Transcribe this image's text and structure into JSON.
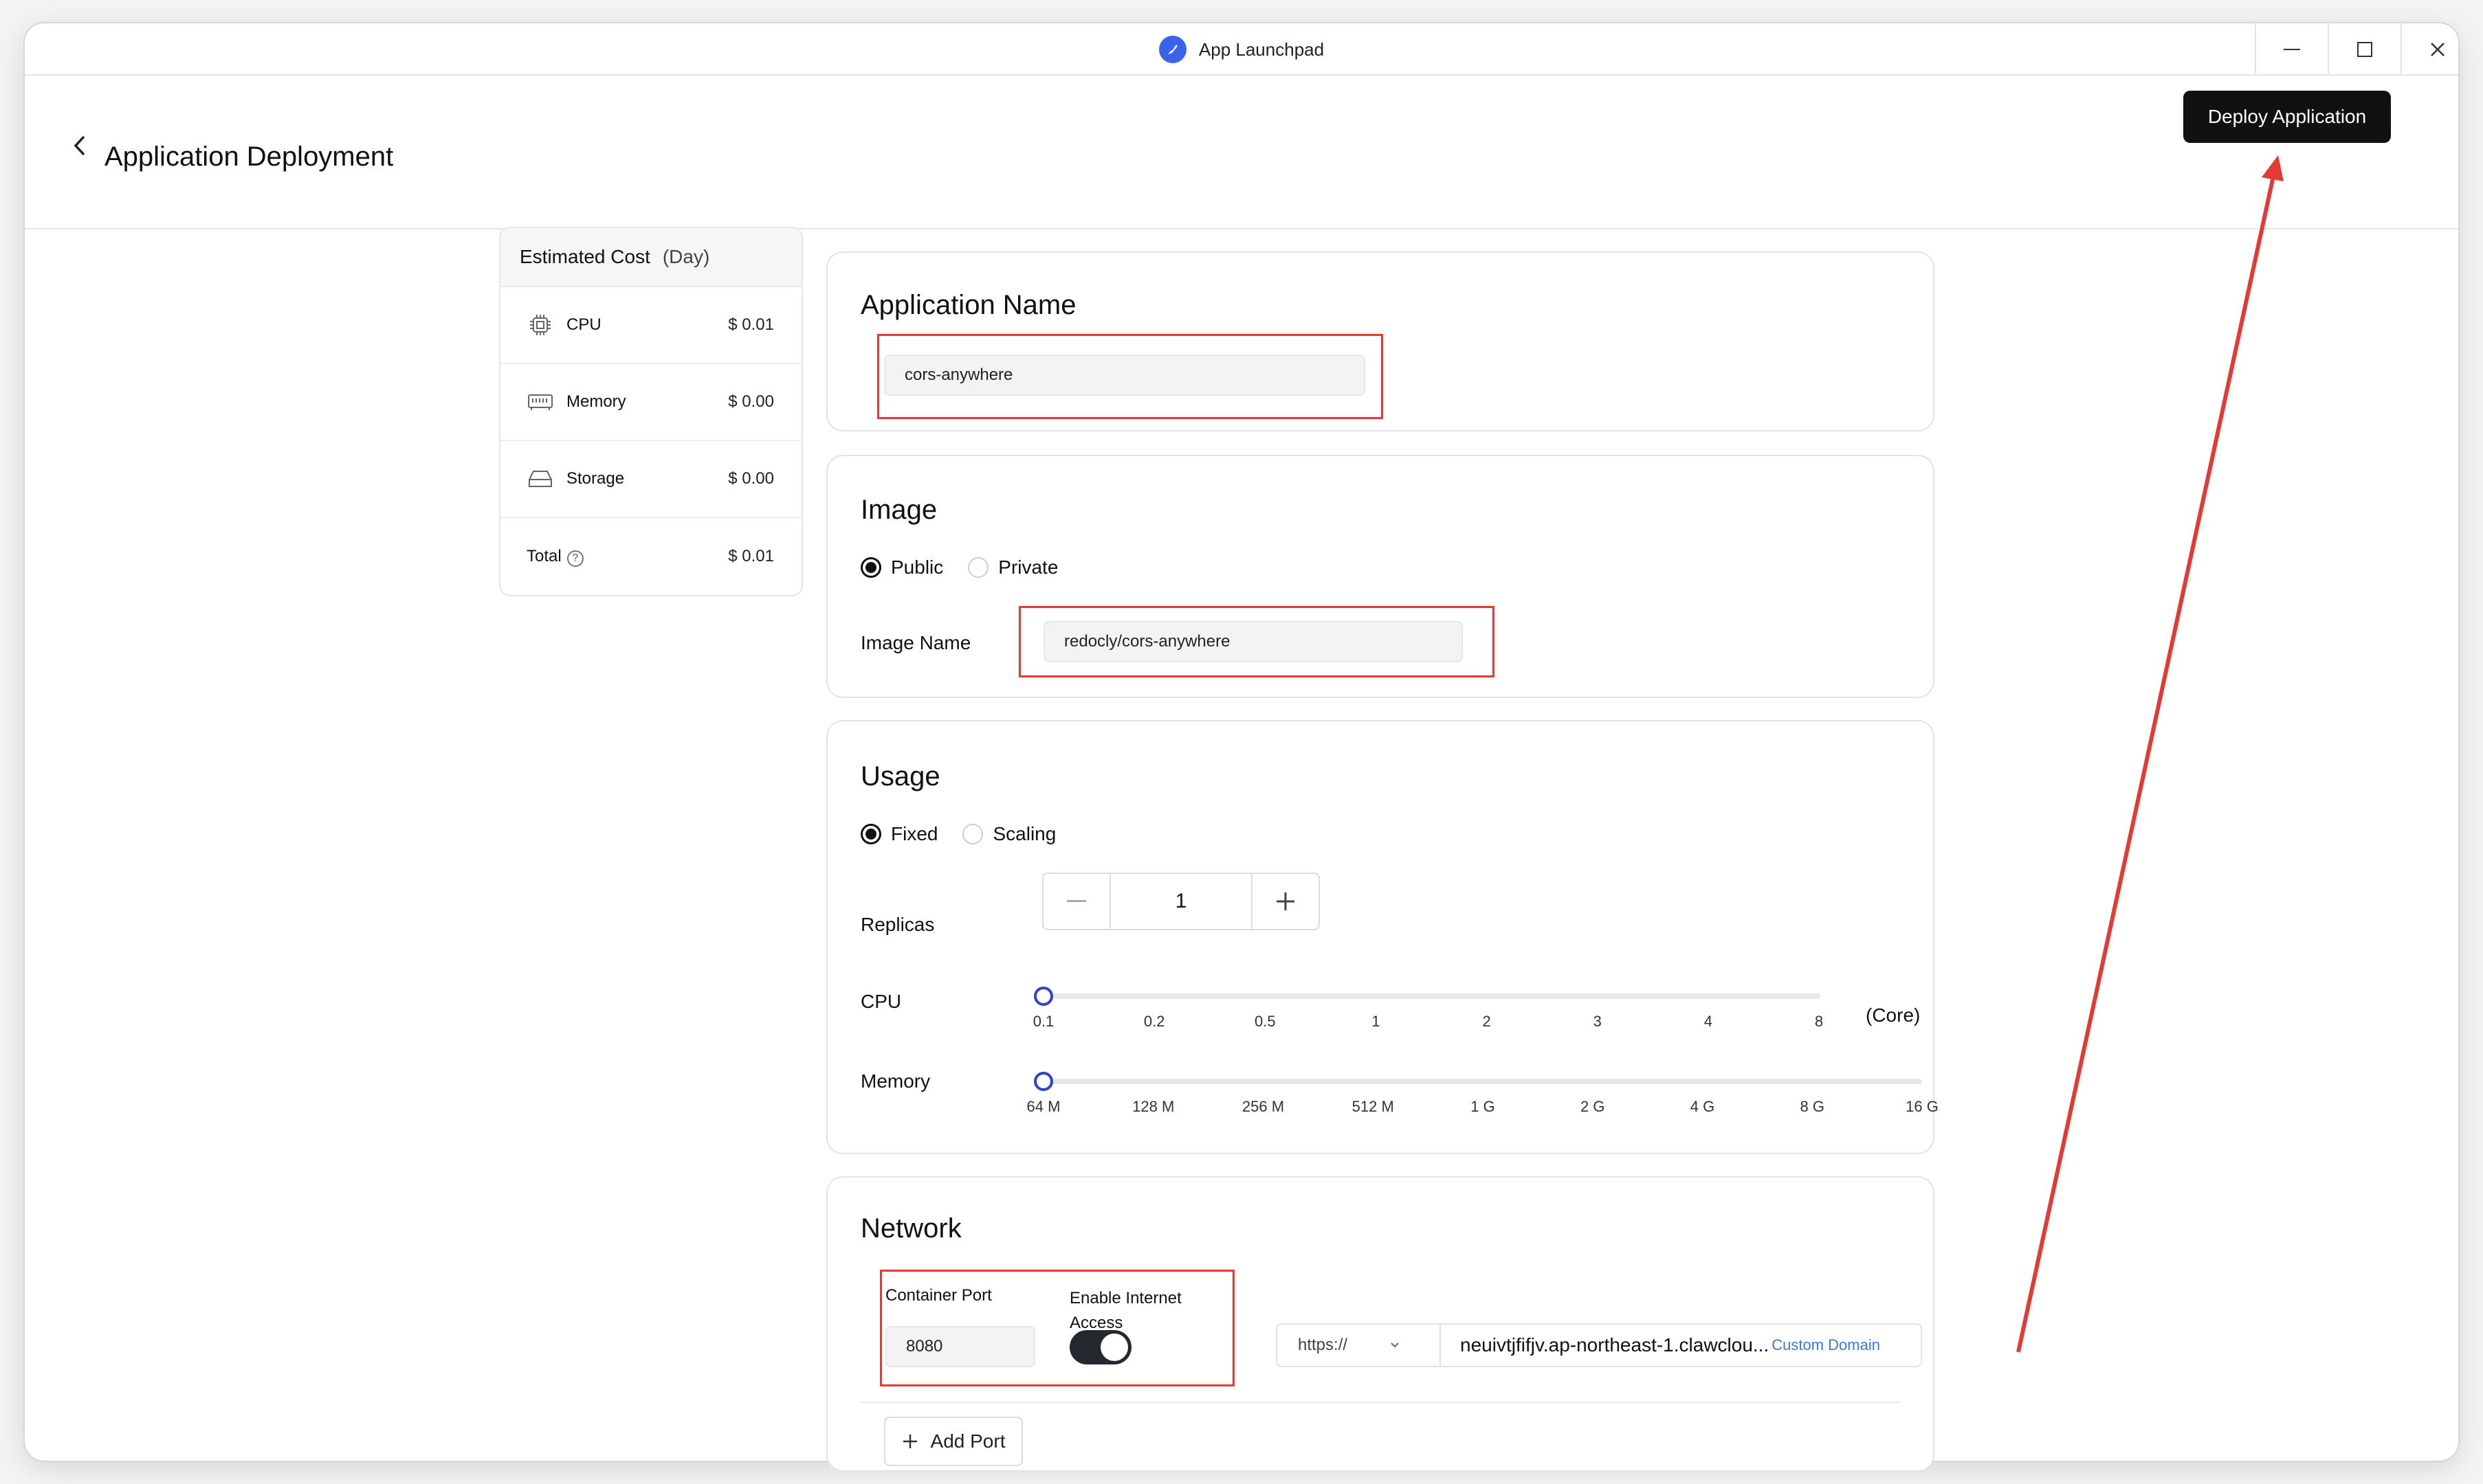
{
  "window": {
    "title": "App Launchpad"
  },
  "header": {
    "title": "Application Deployment",
    "deploy_label": "Deploy Application"
  },
  "cost": {
    "title": "Estimated Cost",
    "unit": "(Day)",
    "rows": [
      {
        "label": "CPU",
        "value": "$ 0.01",
        "icon": "cpu-icon"
      },
      {
        "label": "Memory",
        "value": "$ 0.00",
        "icon": "memory-icon"
      },
      {
        "label": "Storage",
        "value": "$ 0.00",
        "icon": "storage-icon"
      }
    ],
    "total": {
      "label": "Total",
      "value": "$ 0.01"
    }
  },
  "app_name": {
    "title": "Application Name",
    "value": "cors-anywhere"
  },
  "image": {
    "title": "Image",
    "options": [
      "Public",
      "Private"
    ],
    "selected": "Public",
    "name_label": "Image Name",
    "name_value": "redocly/cors-anywhere"
  },
  "usage": {
    "title": "Usage",
    "options": [
      "Fixed",
      "Scaling"
    ],
    "selected": "Fixed",
    "replicas_label": "Replicas",
    "replicas_value": "1",
    "cpu": {
      "label": "CPU",
      "ticks": [
        "0.1",
        "0.2",
        "0.5",
        "1",
        "2",
        "3",
        "4",
        "8"
      ],
      "unit": "(Core)",
      "value": "0.1"
    },
    "memory": {
      "label": "Memory",
      "ticks": [
        "64 M",
        "128 M",
        "256 M",
        "512 M",
        "1 G",
        "2 G",
        "4 G",
        "8 G",
        "16 G"
      ],
      "value": "64 M"
    }
  },
  "network": {
    "title": "Network",
    "port_label": "Container Port",
    "port_value": "8080",
    "internet_label_1": "Enable Internet",
    "internet_label_2": "Access",
    "internet_enabled": true,
    "protocol": "https://",
    "domain": "neuivtjfifjv.ap-northeast-1.clawclou...",
    "custom_domain": "Custom Domain",
    "add_port": "Add Port"
  },
  "colors": {
    "accent": "#3340c8",
    "highlight": "#e53935",
    "primary_button": "#111111"
  }
}
